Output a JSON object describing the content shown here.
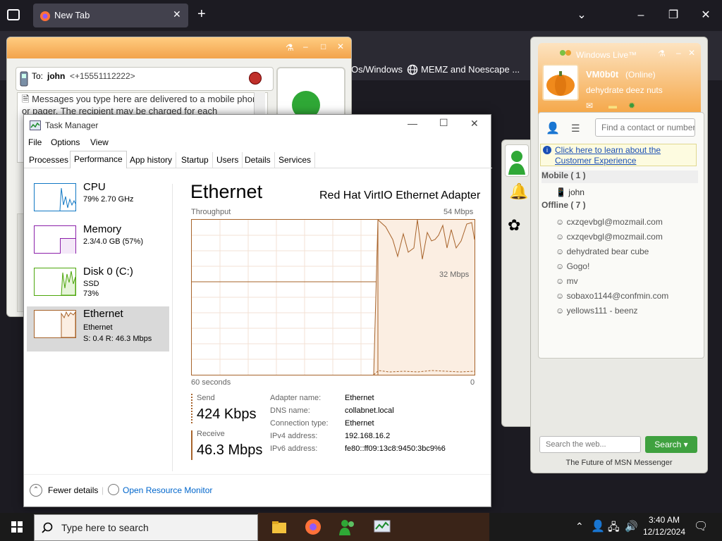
{
  "firefox": {
    "tab_title": "New Tab",
    "bookmarks": [
      "Os/Windows",
      "MEMZ and Noescape ..."
    ]
  },
  "conversation": {
    "to_label": "To:",
    "to_name": "john",
    "to_number": "<+15551112222>",
    "message_text": "Messages you type here are delivered to a mobile phone or pager. The recipient may be charged for each"
  },
  "messenger": {
    "window_title": "Windows Live™",
    "user_name": "VM0b0t",
    "status": "(Online)",
    "personal_message": "dehydrate deez nuts",
    "search_contact_placeholder": "Find a contact or number",
    "info_link": "Click here to learn about the Customer Experience",
    "groups": [
      {
        "label": "Mobile ( 1 )",
        "contacts": [
          "john"
        ]
      },
      {
        "label": "Offline ( 7 )",
        "contacts": [
          "cxzqevbgl@mozmail.com",
          "cxzqevbgl@mozmail.com",
          "dehydrated bear cube",
          "Gogo!",
          "mv",
          "sobaxo1144@confmin.com",
          "yellows111 - beenz"
        ]
      }
    ],
    "web_search_placeholder": "Search the web...",
    "search_button": "Search",
    "footer": "The Future of MSN Messenger"
  },
  "task_manager": {
    "title": "Task Manager",
    "menu": [
      "File",
      "Options",
      "View"
    ],
    "tabs": [
      "Processes",
      "Performance",
      "App history",
      "Startup",
      "Users",
      "Details",
      "Services"
    ],
    "active_tab": "Performance",
    "sidebar": [
      {
        "name": "CPU",
        "line2": "79%  2.70 GHz",
        "line3": "",
        "color": "#1178c4"
      },
      {
        "name": "Memory",
        "line2": "2.3/4.0 GB (57%)",
        "line3": "",
        "color": "#8b1fa9"
      },
      {
        "name": "Disk 0 (C:)",
        "line2": "SSD",
        "line3": "73%",
        "color": "#4da60c"
      },
      {
        "name": "Ethernet",
        "line2": "Ethernet",
        "line3": "S: 0.4  R: 46.3 Mbps",
        "color": "#a7632a"
      }
    ],
    "detail": {
      "heading": "Ethernet",
      "adapter": "Red Hat VirtIO Ethernet Adapter",
      "graph_label": "Throughput",
      "max_label": "54 Mbps",
      "mid_label": "32 Mbps",
      "time_label": "60 seconds",
      "zero_label": "0",
      "send_label": "Send",
      "send_value": "424 Kbps",
      "receive_label": "Receive",
      "receive_value": "46.3 Mbps",
      "props": [
        {
          "k": "Adapter name:",
          "v": "Ethernet"
        },
        {
          "k": "DNS name:",
          "v": "collabnet.local"
        },
        {
          "k": "Connection type:",
          "v": "Ethernet"
        },
        {
          "k": "IPv4 address:",
          "v": "192.168.16.2"
        },
        {
          "k": "IPv6 address:",
          "v": "fe80::ff09:13c8:9450:3bc9%6"
        }
      ]
    },
    "fewer_details": "Fewer details",
    "open_resource_monitor": "Open Resource Monitor"
  },
  "taskbar": {
    "search_placeholder": "Type here to search",
    "time": "3:40 AM",
    "date": "12/12/2024"
  }
}
